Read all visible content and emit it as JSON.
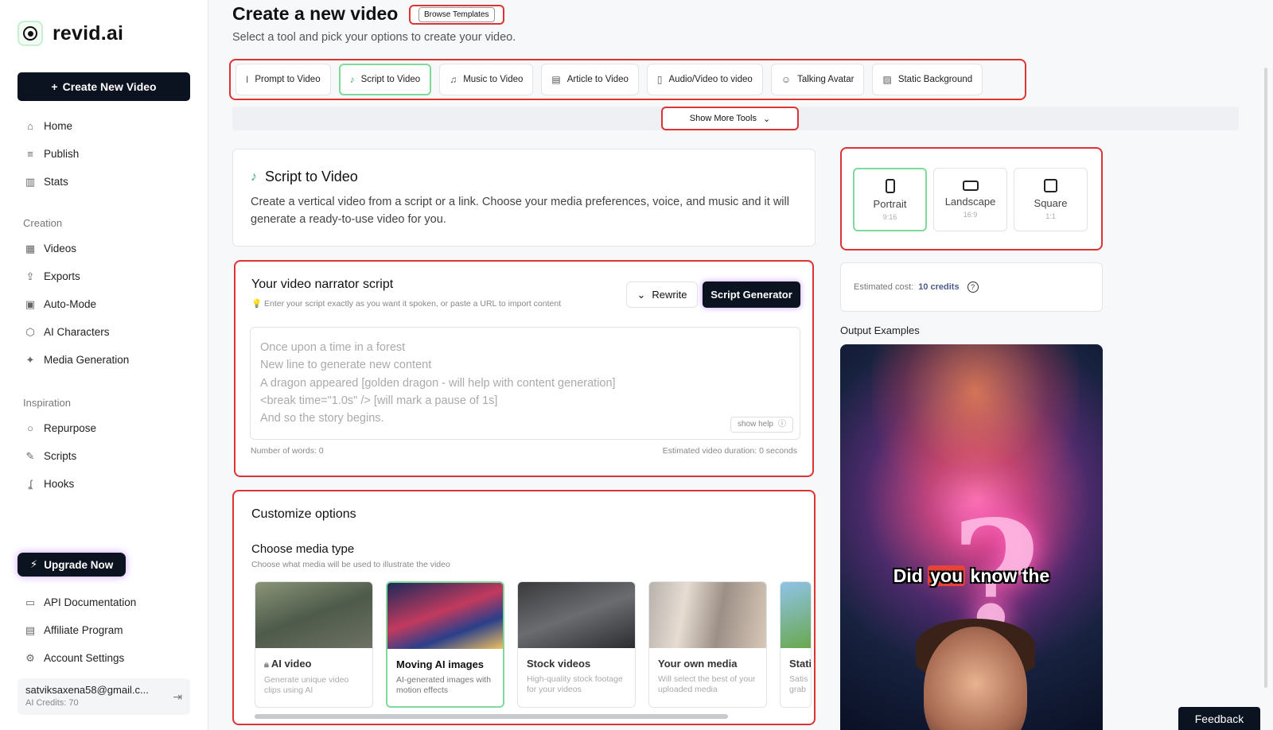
{
  "sidebar": {
    "brand": "revid.ai",
    "create_label": "Create New Video",
    "main_items": [
      {
        "label": "Home",
        "icon": "home-icon"
      },
      {
        "label": "Publish",
        "icon": "publish-icon"
      },
      {
        "label": "Stats",
        "icon": "stats-icon"
      }
    ],
    "creation_header": "Creation",
    "creation_items": [
      {
        "label": "Videos",
        "icon": "grid-icon"
      },
      {
        "label": "Exports",
        "icon": "export-icon"
      },
      {
        "label": "Auto-Mode",
        "icon": "robot-icon"
      },
      {
        "label": "AI Characters",
        "icon": "character-icon"
      },
      {
        "label": "Media Generation",
        "icon": "sparkle-icon"
      }
    ],
    "inspiration_header": "Inspiration",
    "inspiration_items": [
      {
        "label": "Repurpose",
        "icon": "search-icon"
      },
      {
        "label": "Scripts",
        "icon": "edit-icon"
      },
      {
        "label": "Hooks",
        "icon": "hook-icon"
      }
    ],
    "upgrade_label": "Upgrade Now",
    "bottom_items": [
      {
        "label": "API Documentation",
        "icon": "book-icon"
      },
      {
        "label": "Affiliate Program",
        "icon": "money-icon"
      },
      {
        "label": "Account Settings",
        "icon": "gear-icon"
      }
    ],
    "user_email": "satviksaxena58@gmail.c...",
    "user_credits": "AI Credits: 70"
  },
  "header": {
    "title": "Create a new video",
    "browse_label": "Browse Templates",
    "subtitle": "Select a tool and pick your options to create your video."
  },
  "tools": [
    {
      "label": "Prompt to Video",
      "icon": "cursor-icon",
      "active": false
    },
    {
      "label": "Script to Video",
      "icon": "tiktok-icon",
      "active": true
    },
    {
      "label": "Music to Video",
      "icon": "music-icon",
      "active": false
    },
    {
      "label": "Article to Video",
      "icon": "article-icon",
      "active": false
    },
    {
      "label": "Audio/Video to video",
      "icon": "file-audio-icon",
      "active": false
    },
    {
      "label": "Talking Avatar",
      "icon": "avatar-icon",
      "active": false
    },
    {
      "label": "Static Background",
      "icon": "image-icon",
      "active": false
    }
  ],
  "more_tools_label": "Show More Tools",
  "intro": {
    "title": "Script to Video",
    "description": "Create a vertical video from a script or a link. Choose your media preferences, voice, and music and it will generate a ready-to-use video for you."
  },
  "script": {
    "title": "Your video narrator script",
    "hint": "💡 Enter your script exactly as you want it spoken, or paste a URL to import content",
    "rewrite_label": "Rewrite",
    "generator_label": "Script Generator",
    "placeholder_lines": [
      "Once upon a time in a forest",
      "New line to generate new content",
      "A dragon appeared  [golden dragon - will help with content generation]",
      "<break time=\"1.0s\" />  [will mark a pause of 1s]",
      "And so the story begins."
    ],
    "help_label": "show help",
    "word_count": "Number of words: 0",
    "duration": "Estimated video duration: 0 seconds"
  },
  "customize": {
    "title": "Customize options",
    "media_title": "Choose media type",
    "media_sub": "Choose what media will be used to illustrate the video",
    "media": [
      {
        "name": "AI video",
        "desc": "Generate unique video clips using AI",
        "active": false,
        "locked": true
      },
      {
        "name": "Moving AI images",
        "desc": "AI-generated images with motion effects",
        "active": true,
        "locked": false
      },
      {
        "name": "Stock videos",
        "desc": "High-quality stock footage for your videos",
        "active": false,
        "locked": false
      },
      {
        "name": "Your own media",
        "desc": "Will select the best of your uploaded media",
        "active": false,
        "locked": false
      },
      {
        "name": "Stati",
        "desc": "Satis grab",
        "active": false,
        "locked": false
      }
    ]
  },
  "aspect": [
    {
      "label": "Portrait",
      "ratio": "9:16",
      "active": true
    },
    {
      "label": "Landscape",
      "ratio": "16:9",
      "active": false
    },
    {
      "label": "Square",
      "ratio": "1:1",
      "active": false
    }
  ],
  "cost": {
    "label": "Estimated cost:",
    "value": "10 credits"
  },
  "output": {
    "title": "Output Examples",
    "caption_pre": "Did ",
    "caption_hl": "you",
    "caption_post": " know the"
  },
  "feedback_label": "Feedback"
}
